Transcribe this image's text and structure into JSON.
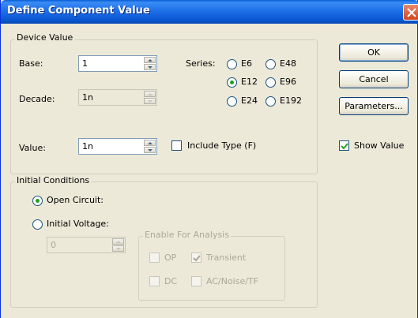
{
  "window": {
    "title": "Define Component Value"
  },
  "device_value": {
    "title": "Device Value",
    "base": {
      "label": "Base:",
      "value": "1"
    },
    "decade": {
      "label": "Decade:",
      "value": "1n"
    },
    "value": {
      "label": "Value:",
      "value": "1n"
    },
    "series": {
      "label": "Series:",
      "options": [
        "E6",
        "E48",
        "E12",
        "E96",
        "E24",
        "E192"
      ],
      "selected": "E12"
    },
    "include_type": {
      "label": "Include Type (F)",
      "checked": false
    }
  },
  "initial_conditions": {
    "title": "Initial Conditions",
    "open_circuit": {
      "label": "Open Circuit:",
      "checked": true
    },
    "initial_voltage": {
      "label": "Initial Voltage:",
      "checked": false,
      "value": "0"
    },
    "enable_for_analysis": {
      "title": "Enable For Analysis",
      "op": {
        "label": "OP",
        "checked": false
      },
      "transient": {
        "label": "Transient",
        "checked": true
      },
      "dc": {
        "label": "DC",
        "checked": false
      },
      "ac": {
        "label": "AC/Noise/TF",
        "checked": false
      }
    }
  },
  "buttons": {
    "ok": "OK",
    "cancel": "Cancel",
    "parameters": "Parameters..."
  },
  "show_value": {
    "label": "Show Value",
    "checked": true
  },
  "colors": {
    "title_bar": "#0a55d0",
    "radio_dot": "#21a121",
    "face": "#ece9d8"
  },
  "icons": {
    "close": "close-icon"
  }
}
